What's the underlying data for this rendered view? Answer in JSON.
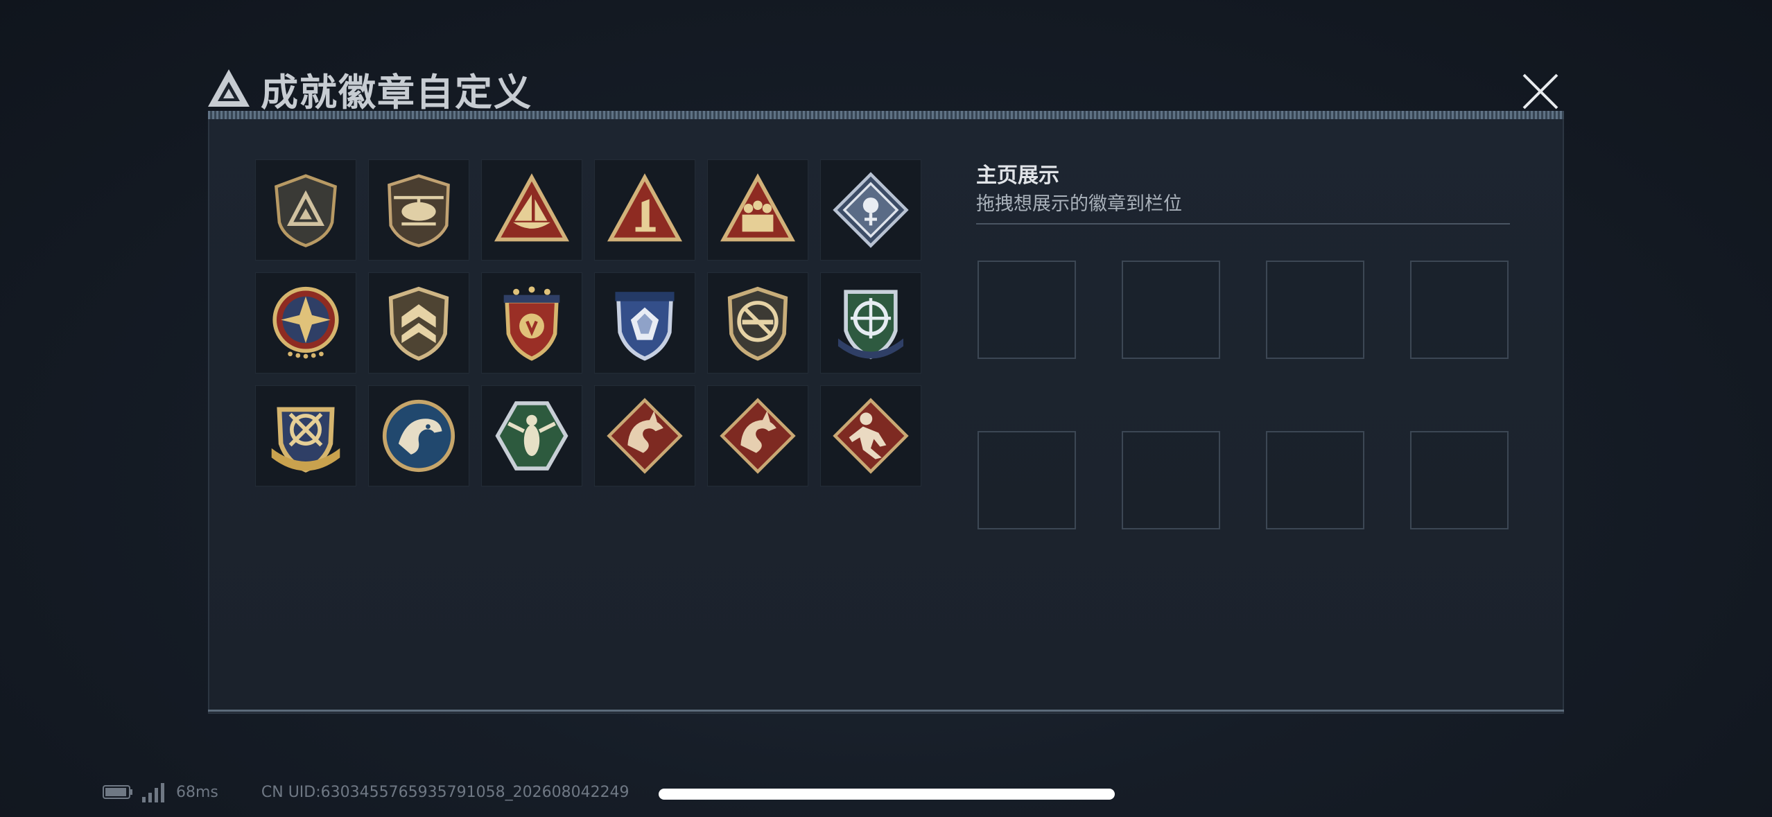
{
  "header": {
    "title": "成就徽章自定义",
    "logo_icon": "delta-triangle-logo-icon",
    "close_icon": "close-icon"
  },
  "badges": [
    {
      "name": "badge-shield-triangle",
      "icon": "shield-triangle-badge-icon"
    },
    {
      "name": "badge-helicopter",
      "icon": "helicopter-badge-icon"
    },
    {
      "name": "badge-triangle-boat",
      "icon": "triangle-boat-badge-icon"
    },
    {
      "name": "badge-triangle-number-one",
      "icon": "triangle-number-one-badge-icon"
    },
    {
      "name": "badge-triangle-soldiers",
      "icon": "triangle-soldiers-badge-icon"
    },
    {
      "name": "badge-diamond-rose",
      "icon": "diamond-rose-badge-icon"
    },
    {
      "name": "badge-star-compass",
      "icon": "star-compass-badge-icon"
    },
    {
      "name": "badge-shield-chevron",
      "icon": "shield-chevron-badge-icon"
    },
    {
      "name": "badge-red-shield-stars",
      "icon": "red-shield-stars-badge-icon"
    },
    {
      "name": "badge-blue-shield-gem",
      "icon": "blue-shield-gem-badge-icon"
    },
    {
      "name": "badge-no-rifle",
      "icon": "no-rifle-badge-icon"
    },
    {
      "name": "badge-green-crosshair",
      "icon": "green-crosshair-badge-icon"
    },
    {
      "name": "badge-gold-crosshair-shield",
      "icon": "gold-crosshair-shield-badge-icon"
    },
    {
      "name": "badge-eagle",
      "icon": "eagle-badge-icon"
    },
    {
      "name": "badge-green-hexagon-wasp",
      "icon": "green-hexagon-wasp-badge-icon"
    },
    {
      "name": "badge-red-dragon-1",
      "icon": "red-dragon-badge-icon"
    },
    {
      "name": "badge-red-dragon-2",
      "icon": "red-dragon-badge-icon"
    },
    {
      "name": "badge-red-runner",
      "icon": "red-runner-badge-icon"
    }
  ],
  "showcase": {
    "title": "主页展示",
    "subtitle": "拖拽想展示的徽章到栏位",
    "slot_count": 8
  },
  "footer": {
    "ping": "68ms",
    "uid": "CN UID:6303455765935791058_202608042249",
    "battery_icon": "battery-icon",
    "signal_icon": "signal-icon"
  },
  "colors": {
    "gold": "#c9a86a",
    "red": "#8c2a22",
    "blue": "#2b4a7a",
    "green": "#2d5a3e",
    "panel_bg": "#1c232d"
  }
}
